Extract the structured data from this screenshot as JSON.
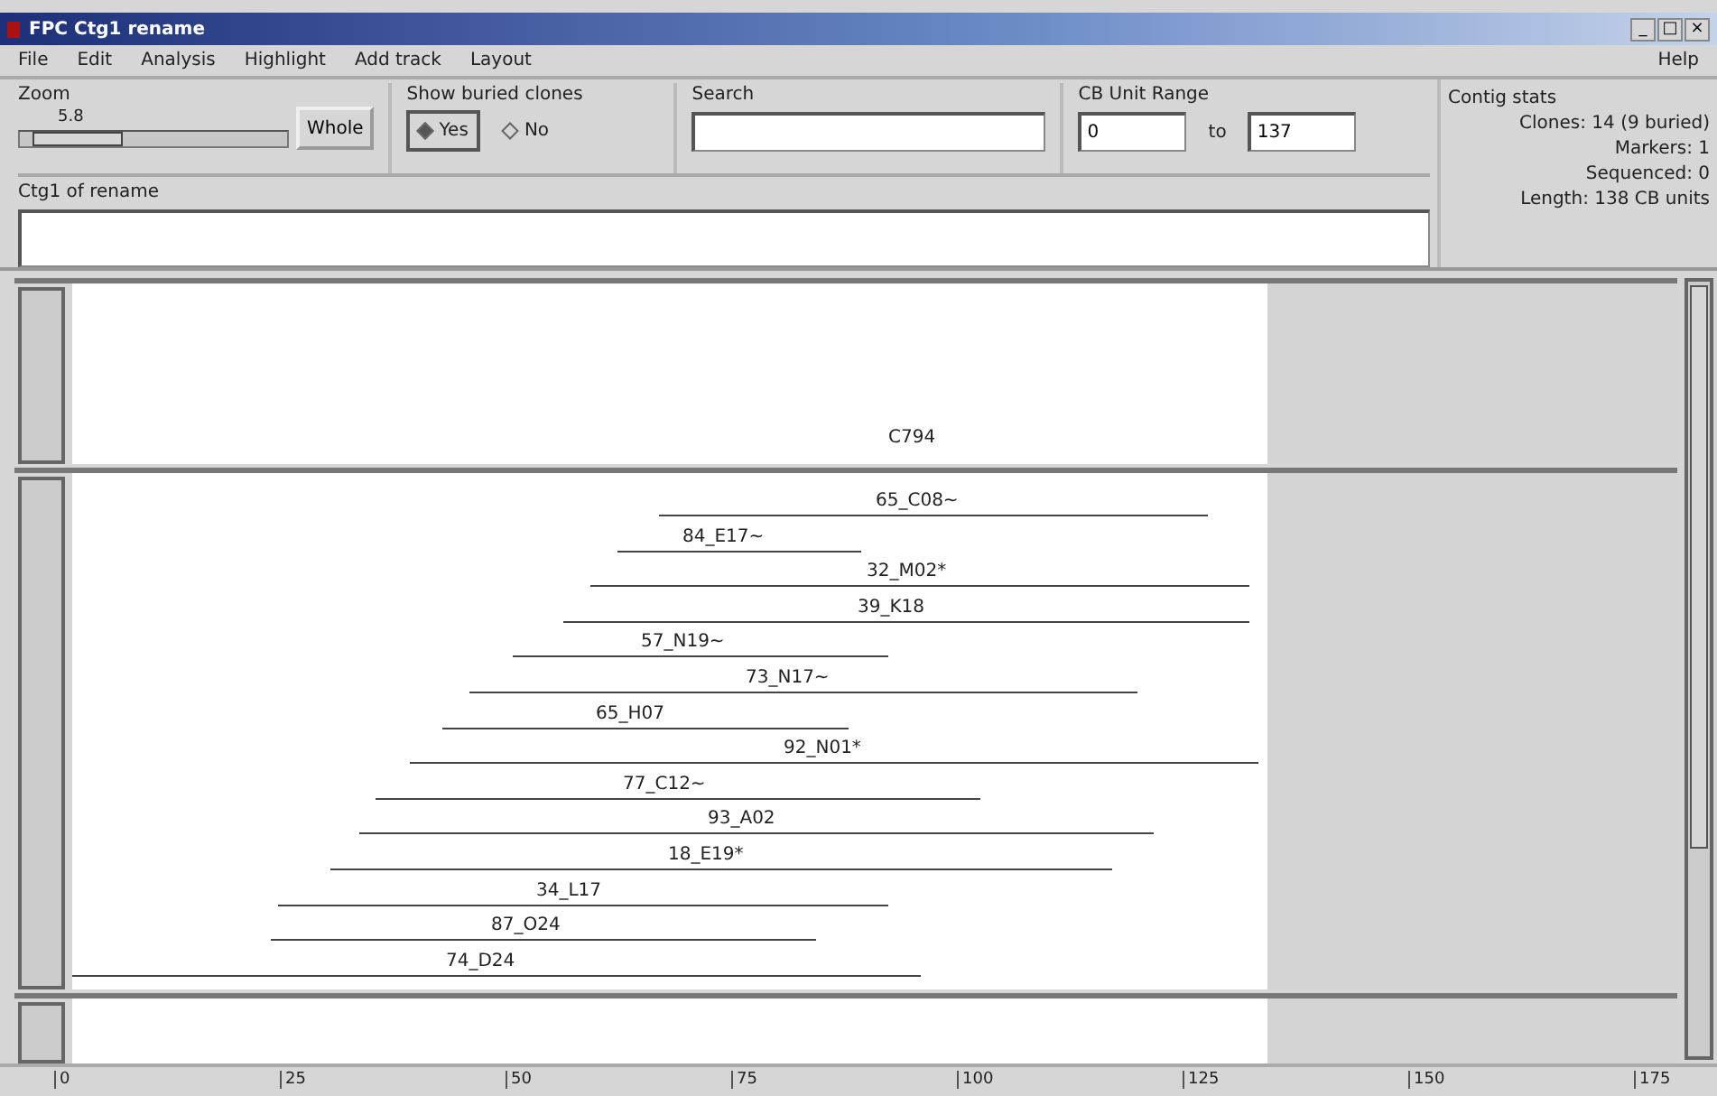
{
  "window": {
    "title": "FPC Ctg1 rename",
    "controls": [
      "_",
      "□",
      "×"
    ]
  },
  "menu": [
    {
      "label": "File"
    },
    {
      "label": "Edit"
    },
    {
      "label": "Analysis"
    },
    {
      "label": "Highlight"
    },
    {
      "label": "Add track"
    },
    {
      "label": "Layout"
    }
  ],
  "help_menu": "Help",
  "zoom": {
    "label": "Zoom",
    "reading": "5.8",
    "level": 0.05,
    "whole_button": "Whole"
  },
  "show_buried": {
    "label": "Show buried clones",
    "options": [
      {
        "label": "Yes",
        "selected": true
      },
      {
        "label": "No",
        "selected": false
      }
    ]
  },
  "search": {
    "label": "Search"
  },
  "cb_range": {
    "label": "CB Unit Range",
    "from": "0",
    "to_label": "to",
    "to": "137"
  },
  "contig_stats": {
    "title": "Contig stats",
    "lines": [
      "Clones: 14 (9 buried)",
      "Markers: 1",
      "Sequenced: 0",
      "Length: 138 CB units"
    ]
  },
  "contig_name": {
    "label": "Ctg1 of rename"
  },
  "marker_track": {
    "markers": [
      "C794"
    ]
  },
  "clone_track": {
    "clones": [
      "65_C08~",
      "84_E17~",
      "32_M02*",
      "39_K18",
      "57_N19~",
      "73_N17~",
      "65_H07",
      "92_N01*",
      "77_C12~",
      "93_A02",
      "18_E19*",
      "34_L17",
      "87_O24",
      "74_D24"
    ]
  },
  "ruler": {
    "ticks": [
      "0",
      "25",
      "50",
      "75",
      "100",
      "125",
      "150",
      "175"
    ]
  }
}
